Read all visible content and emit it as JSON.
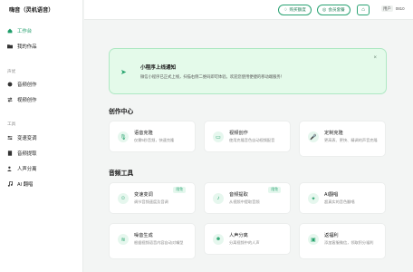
{
  "sidebar": {
    "logo": "嗨音（灵机语音）",
    "items_top": [
      {
        "label": "工作台",
        "icon": "home-icon",
        "active": true
      },
      {
        "label": "我的作品",
        "icon": "folder-icon",
        "active": false
      }
    ],
    "section_voice": "声优",
    "items_voice": [
      {
        "label": "音频创作",
        "icon": "speech-bubble-icon"
      },
      {
        "label": "视频创作",
        "icon": "swap-icon"
      }
    ],
    "section_tools": "工具",
    "items_tools": [
      {
        "label": "变速变调",
        "icon": "sliders-icon"
      },
      {
        "label": "音频提取",
        "icon": "file-audio-icon"
      },
      {
        "label": "人声分离",
        "icon": "person-voice-icon"
      },
      {
        "label": "AI 翻唱",
        "icon": "music-note-icon"
      }
    ]
  },
  "header": {
    "buy_label": "购买额度",
    "member_label": "会员套餐",
    "user_name": "用户",
    "user_id": "0810"
  },
  "banner": {
    "title": "小程序上线通知",
    "desc": "微信小程序已正式上线，扫描右侧二维码即可体验。欢迎您使用便捷的移动端服务！",
    "close": "×"
  },
  "creation": {
    "title": "创作中心",
    "cards": [
      {
        "title": "语音克隆",
        "desc": "仅需5秒音频，快速克隆",
        "icon": "mic-icon",
        "badge": ""
      },
      {
        "title": "视频创作",
        "desc": "使用克隆音色自动视频配音",
        "icon": "video-icon",
        "badge": ""
      },
      {
        "title": "定制克隆",
        "desc": "更高表、更快、精调的声音克隆",
        "icon": "mic-icon",
        "badge": ""
      }
    ]
  },
  "tools": {
    "title": "音频工具",
    "cards": [
      {
        "title": "变速变调",
        "desc": "调节音频速度及音调",
        "icon": "smile-icon",
        "badge": "限免"
      },
      {
        "title": "音频提取",
        "desc": "从视频中提取音频",
        "icon": "music-note-icon",
        "badge": "限免"
      },
      {
        "title": "AI翻唱",
        "desc": "超真实的音色翻唱",
        "icon": "sparkle-icon",
        "badge": ""
      },
      {
        "title": "噪音生成",
        "desc": "根据视频语音内容自动对嘴型",
        "icon": "wave-icon",
        "badge": ""
      },
      {
        "title": "人声分离",
        "desc": "分离视频中的人声",
        "icon": "person-voice-icon",
        "badge": ""
      },
      {
        "title": "返福利",
        "desc": "添加客服微信，领取积分福利",
        "icon": "gift-icon",
        "badge": ""
      }
    ]
  }
}
